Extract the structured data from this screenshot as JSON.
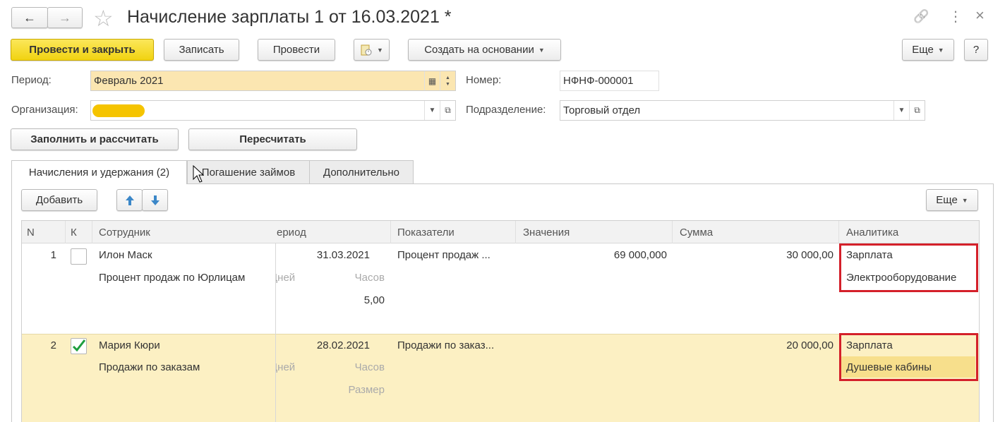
{
  "window": {
    "title": "Начисление зарплаты 1 от 16.03.2021 *",
    "nav_back": "←",
    "nav_forward": "→",
    "star": "☆",
    "link_icon": "🔗",
    "menu_icon": "⋮",
    "close_icon": "×"
  },
  "toolbar": {
    "post_close": "Провести и закрыть",
    "save": "Записать",
    "post": "Провести",
    "create_based": "Создать на основании",
    "more": "Еще",
    "help": "?"
  },
  "header": {
    "period_label": "Период:",
    "period_value": "Февраль 2021",
    "number_label": "Номер:",
    "number_value": "НФНФ-000001",
    "org_label": "Организация:",
    "org_value": "",
    "dept_label": "Подразделение:",
    "dept_value": "Торговый отдел"
  },
  "actions": {
    "fill_calc": "Заполнить и рассчитать",
    "recalc": "Пересчитать"
  },
  "tabs": [
    {
      "label": "Начисления и удержания (2)"
    },
    {
      "label": "Погашение займов"
    },
    {
      "label": "Дополнительно"
    }
  ],
  "table_toolbar": {
    "add": "Добавить",
    "more": "Еще"
  },
  "table": {
    "columns": [
      "N",
      "К",
      "Сотрудник",
      "ериод",
      "Показатели",
      "Значения",
      "Сумма",
      "Аналитика"
    ],
    "rows": [
      {
        "n": "1",
        "checked": false,
        "employee": "Илон Маск",
        "accrual": "Процент продаж по Юрлицам",
        "period": "31.03.2021",
        "days": "Дней",
        "hours": "Часов",
        "extra": "5,00",
        "indicator": "Процент продаж ...",
        "value": "69 000,000",
        "sum": "30 000,00",
        "analytics1": "Зарплата",
        "analytics2": "Электрооборудование"
      },
      {
        "n": "2",
        "checked": true,
        "employee": "Мария Кюри",
        "accrual": "Продажи по заказам",
        "period": "28.02.2021",
        "days": "Дней",
        "hours": "Часов",
        "extra": "Размер",
        "indicator": "Продажи по заказ...",
        "value": "",
        "sum": "20 000,00",
        "analytics1": "Зарплата",
        "analytics2": "Душевые кабины"
      }
    ]
  },
  "colors": {
    "primary_button": "#f1d311",
    "highlight_row": "#fcf0c3",
    "field_yellow": "#fbe6b1",
    "annotation_red": "#d4202a"
  }
}
